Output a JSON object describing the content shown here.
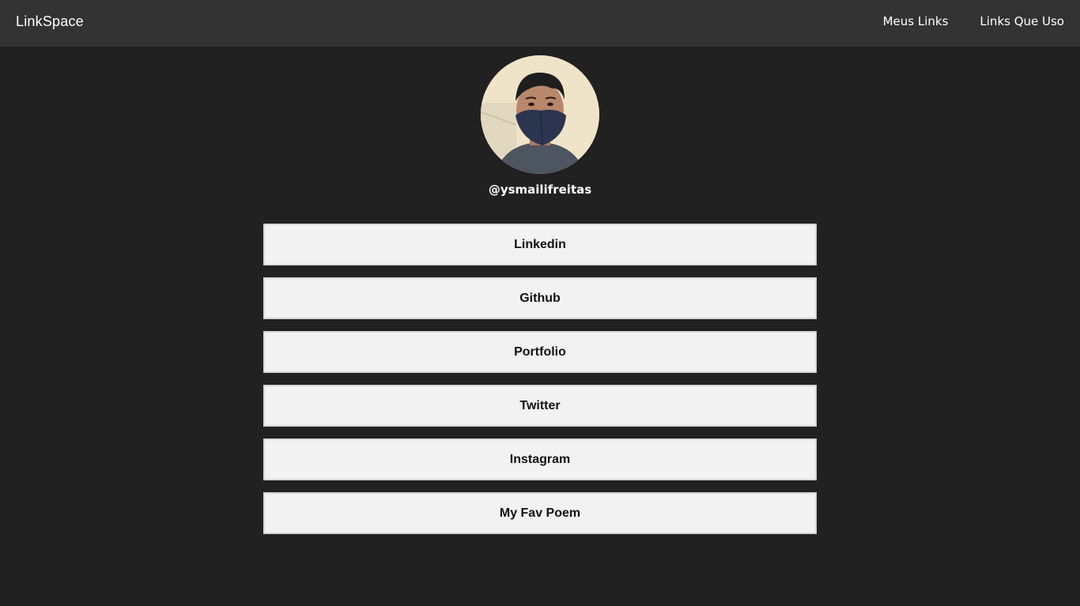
{
  "header": {
    "brand": "LinkSpace",
    "nav": [
      {
        "label": "Meus Links"
      },
      {
        "label": "Links Que Uso"
      }
    ]
  },
  "profile": {
    "avatar_icon": "profile-photo-masked-person",
    "handle": "@ysmailifreitas"
  },
  "links": [
    {
      "label": "Linkedin"
    },
    {
      "label": "Github"
    },
    {
      "label": "Portfolio"
    },
    {
      "label": "Twitter"
    },
    {
      "label": "Instagram"
    },
    {
      "label": "My Fav Poem"
    }
  ],
  "colors": {
    "background": "#212121",
    "topbar": "#333333",
    "button": "#f2f2f2"
  }
}
